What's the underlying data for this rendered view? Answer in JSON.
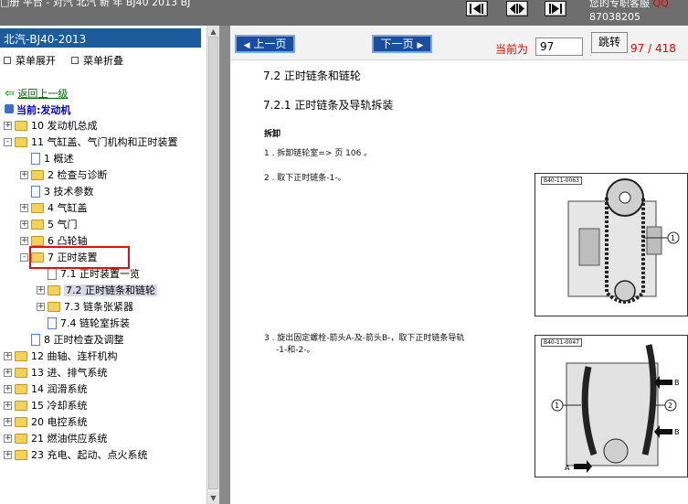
{
  "window": {
    "title": "□册 平台 - 对汽 北汽 新 年 BJ40 2013 BJ",
    "service_text": "您的专职客服",
    "service_qq": "QQ",
    "phone": "87038205"
  },
  "toolbar": {
    "icons": [
      "first-page-icon",
      "split-view-icon",
      "last-page-icon"
    ]
  },
  "sidebar": {
    "title": "北汽-BJ40-2013",
    "expand_label": "菜单展开",
    "collapse_label": "菜单折叠",
    "back_label": "返回上一级",
    "current_label": "当前:发动机",
    "tree": [
      {
        "label": "10 发动机总成",
        "level": 0,
        "type": "folder",
        "expander": "+"
      },
      {
        "label": "11 气缸盖、气门机构和正时装置",
        "level": 0,
        "type": "folder",
        "expander": "-"
      },
      {
        "label": "1 概述",
        "level": 1,
        "type": "doc",
        "expander": ""
      },
      {
        "label": "2 检查与诊断",
        "level": 1,
        "type": "folder",
        "expander": "+"
      },
      {
        "label": "3 技术参数",
        "level": 1,
        "type": "doc",
        "expander": ""
      },
      {
        "label": "4 气缸盖",
        "level": 1,
        "type": "folder",
        "expander": "+"
      },
      {
        "label": "5 气门",
        "level": 1,
        "type": "folder",
        "expander": "+"
      },
      {
        "label": "6 凸轮轴",
        "level": 1,
        "type": "folder",
        "expander": "+"
      },
      {
        "label": "7 正时装置",
        "level": 1,
        "type": "folder",
        "expander": "-"
      },
      {
        "label": "7.1 正时装置一览",
        "level": 2,
        "type": "doc",
        "expander": ""
      },
      {
        "label": "7.2 正时链条和链轮",
        "level": 2,
        "type": "folder",
        "expander": "+",
        "selected": true
      },
      {
        "label": "7.3 链条张紧器",
        "level": 2,
        "type": "folder",
        "expander": "+"
      },
      {
        "label": "7.4 链轮室拆装",
        "level": 2,
        "type": "doc",
        "expander": ""
      },
      {
        "label": "8 正时检查及调整",
        "level": 1,
        "type": "doc",
        "expander": ""
      },
      {
        "label": "12 曲轴、连杆机构",
        "level": 0,
        "type": "folder",
        "expander": "+"
      },
      {
        "label": "13 进、排气系统",
        "level": 0,
        "type": "folder",
        "expander": "+"
      },
      {
        "label": "14 润滑系统",
        "level": 0,
        "type": "folder",
        "expander": "+"
      },
      {
        "label": "15 冷却系统",
        "level": 0,
        "type": "folder",
        "expander": "+"
      },
      {
        "label": "20 电控系统",
        "level": 0,
        "type": "folder",
        "expander": "+"
      },
      {
        "label": "21 燃油供应系统",
        "level": 0,
        "type": "folder",
        "expander": "+"
      },
      {
        "label": "23 充电、起动、点火系统",
        "level": 0,
        "type": "folder",
        "expander": "+"
      }
    ]
  },
  "pager": {
    "prev_label": "上一页",
    "next_label": "下一页",
    "current_label": "当前为",
    "page_value": "97",
    "jump_label": "跳转",
    "page_count": "97 / 418"
  },
  "document": {
    "heading": "7.2 正时链条和链轮",
    "subheading": "7.2.1 正时链条及导轨拆装",
    "section": "拆卸",
    "steps": [
      "1 . 拆卸链轮室=> 页 106 。",
      "2 . 取下正时链条-1-。",
      "3 . 旋出固定螺栓-箭头A-及-箭头B-，取下正时链条导轨",
      "-1-和-2-。"
    ],
    "figures": [
      {
        "id": "B40-11-0063",
        "callouts": [
          "1"
        ]
      },
      {
        "id": "B40-11-0047",
        "callouts": [
          "1",
          "2",
          "A",
          "B"
        ]
      }
    ]
  }
}
